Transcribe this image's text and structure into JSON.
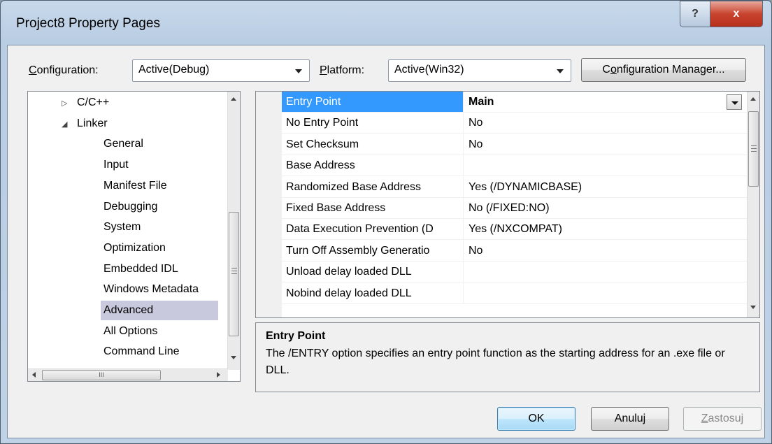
{
  "window": {
    "title": "Project8 Property Pages",
    "help_glyph": "?",
    "close_glyph": "x"
  },
  "config": {
    "configuration_label_ul": "C",
    "configuration_label_rest": "onfiguration:",
    "configuration_value": "Active(Debug)",
    "platform_label_ul": "P",
    "platform_label_rest": "latform:",
    "platform_value": "Active(Win32)",
    "manager_button_ul": "o",
    "manager_button_pre": "C",
    "manager_button_rest": "nfiguration Manager..."
  },
  "tree": {
    "items": [
      {
        "label": "C/C++",
        "indent": 1,
        "arrow": "▷",
        "selected": false
      },
      {
        "label": "Linker",
        "indent": 1,
        "arrow": "◢",
        "selected": false
      },
      {
        "label": "General",
        "indent": 2,
        "arrow": "",
        "selected": false
      },
      {
        "label": "Input",
        "indent": 2,
        "arrow": "",
        "selected": false
      },
      {
        "label": "Manifest File",
        "indent": 2,
        "arrow": "",
        "selected": false
      },
      {
        "label": "Debugging",
        "indent": 2,
        "arrow": "",
        "selected": false
      },
      {
        "label": "System",
        "indent": 2,
        "arrow": "",
        "selected": false
      },
      {
        "label": "Optimization",
        "indent": 2,
        "arrow": "",
        "selected": false
      },
      {
        "label": "Embedded IDL",
        "indent": 2,
        "arrow": "",
        "selected": false
      },
      {
        "label": "Windows Metadata",
        "indent": 2,
        "arrow": "",
        "selected": false
      },
      {
        "label": "Advanced",
        "indent": 2,
        "arrow": "",
        "selected": true
      },
      {
        "label": "All Options",
        "indent": 2,
        "arrow": "",
        "selected": false
      },
      {
        "label": "Command Line",
        "indent": 2,
        "arrow": "",
        "selected": false
      }
    ],
    "hscroll_thumb_glyph": "III"
  },
  "properties": [
    {
      "name": "Entry Point",
      "value": "Main",
      "selected": true
    },
    {
      "name": "No Entry Point",
      "value": "No",
      "selected": false
    },
    {
      "name": "Set Checksum",
      "value": "No",
      "selected": false
    },
    {
      "name": "Base Address",
      "value": "",
      "selected": false
    },
    {
      "name": "Randomized Base Address",
      "value": "Yes (/DYNAMICBASE)",
      "selected": false
    },
    {
      "name": "Fixed Base Address",
      "value": "No (/FIXED:NO)",
      "selected": false
    },
    {
      "name": "Data Execution Prevention (D",
      "value": "Yes (/NXCOMPAT)",
      "selected": false
    },
    {
      "name": "Turn Off Assembly Generatio",
      "value": "No",
      "selected": false
    },
    {
      "name": "Unload delay loaded DLL",
      "value": "",
      "selected": false
    },
    {
      "name": "Nobind delay loaded DLL",
      "value": "",
      "selected": false
    }
  ],
  "description": {
    "title": "Entry Point",
    "text": "The /ENTRY option specifies an entry point function as the starting address for an .exe file or DLL."
  },
  "buttons": {
    "ok": "OK",
    "cancel": "Anuluj",
    "apply_ul": "Z",
    "apply_rest": "astosuj"
  }
}
